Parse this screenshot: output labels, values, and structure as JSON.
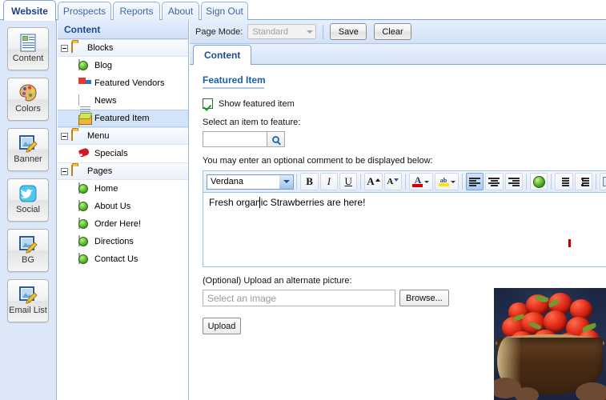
{
  "app": {
    "top_tabs": [
      {
        "label": "Website",
        "active": true
      },
      {
        "label": "Prospects",
        "active": false
      },
      {
        "label": "Reports",
        "active": false
      },
      {
        "label": "About",
        "active": false
      },
      {
        "label": "Sign Out",
        "active": false
      }
    ]
  },
  "rail": {
    "items": [
      {
        "label": "Content",
        "icon": "document-icon"
      },
      {
        "label": "Colors",
        "icon": "palette-icon"
      },
      {
        "label": "Banner",
        "icon": "image-edit-icon"
      },
      {
        "label": "Social",
        "icon": "twitter-icon"
      },
      {
        "label": "BG",
        "icon": "image-edit-icon"
      },
      {
        "label": "Email List",
        "icon": "image-edit-icon"
      }
    ]
  },
  "tree": {
    "header": "Content",
    "nodes": [
      {
        "label": "Blocks",
        "icon": "folder-icon",
        "type": "group",
        "expanded": true,
        "selected": false
      },
      {
        "label": "Blog",
        "icon": "page-globe-icon",
        "type": "child",
        "selected": false
      },
      {
        "label": "Featured Vendors",
        "icon": "truck-icon",
        "type": "child",
        "selected": false
      },
      {
        "label": "News",
        "icon": "news-doc-icon",
        "type": "child",
        "selected": false
      },
      {
        "label": "Featured Item",
        "icon": "box-icon",
        "type": "child",
        "selected": true
      },
      {
        "label": "Menu",
        "icon": "folder-icon",
        "type": "group",
        "expanded": true,
        "selected": false
      },
      {
        "label": "Specials",
        "icon": "tag-icon",
        "type": "child",
        "selected": false
      },
      {
        "label": "Pages",
        "icon": "folder-icon",
        "type": "group",
        "expanded": true,
        "selected": false
      },
      {
        "label": "Home",
        "icon": "page-globe-icon",
        "type": "child",
        "selected": false
      },
      {
        "label": "About Us",
        "icon": "page-globe-icon",
        "type": "child",
        "selected": false
      },
      {
        "label": "Order Here!",
        "icon": "page-globe-icon",
        "type": "child",
        "selected": false
      },
      {
        "label": "Directions",
        "icon": "page-globe-icon",
        "type": "child",
        "selected": false
      },
      {
        "label": "Contact Us",
        "icon": "page-globe-icon",
        "type": "child",
        "selected": false
      }
    ]
  },
  "toolbar": {
    "page_mode_label": "Page Mode:",
    "page_mode_value": "Standard",
    "save_label": "Save",
    "clear_label": "Clear"
  },
  "content_tab": {
    "label": "Content"
  },
  "form": {
    "section_title": "Featured Item",
    "show_featured_label": "Show featured item",
    "show_featured_checked": true,
    "select_item_label": "Select an item to feature:",
    "select_item_value": "",
    "comment_label": "You may enter an optional comment to be displayed below:",
    "upload_label": "(Optional) Upload an alternate picture:",
    "upload_placeholder": "Select an image",
    "browse_label": "Browse...",
    "upload_button_label": "Upload"
  },
  "editor": {
    "font_value": "Verdana",
    "body_text": "Fresh organic Strawberries are here!",
    "buttons": [
      {
        "name": "bold",
        "glyph": "B"
      },
      {
        "name": "italic",
        "glyph": "I"
      },
      {
        "name": "underline",
        "glyph": "U"
      },
      {
        "name": "increase-font-size",
        "glyph": "A"
      },
      {
        "name": "decrease-font-size",
        "glyph": "A"
      },
      {
        "name": "font-color",
        "glyph": "A"
      },
      {
        "name": "highlight-color",
        "glyph": "ab"
      },
      {
        "name": "align-left",
        "glyph": ""
      },
      {
        "name": "align-center",
        "glyph": ""
      },
      {
        "name": "align-right",
        "glyph": ""
      },
      {
        "name": "insert-link",
        "glyph": ""
      },
      {
        "name": "numbered-list",
        "glyph": ""
      },
      {
        "name": "bullet-list",
        "glyph": ""
      },
      {
        "name": "edit-source",
        "glyph": ""
      }
    ],
    "active_button": "align-left"
  },
  "photo": {
    "alt": "Bowl of fresh strawberries held in hands"
  },
  "colors": {
    "accent": "#1b5fa8",
    "tab_active_text": "#1b3f7a",
    "panel_blue": "#dce8f7",
    "selection": "#d3e4f8",
    "strawberry_red": "#e02a18"
  }
}
